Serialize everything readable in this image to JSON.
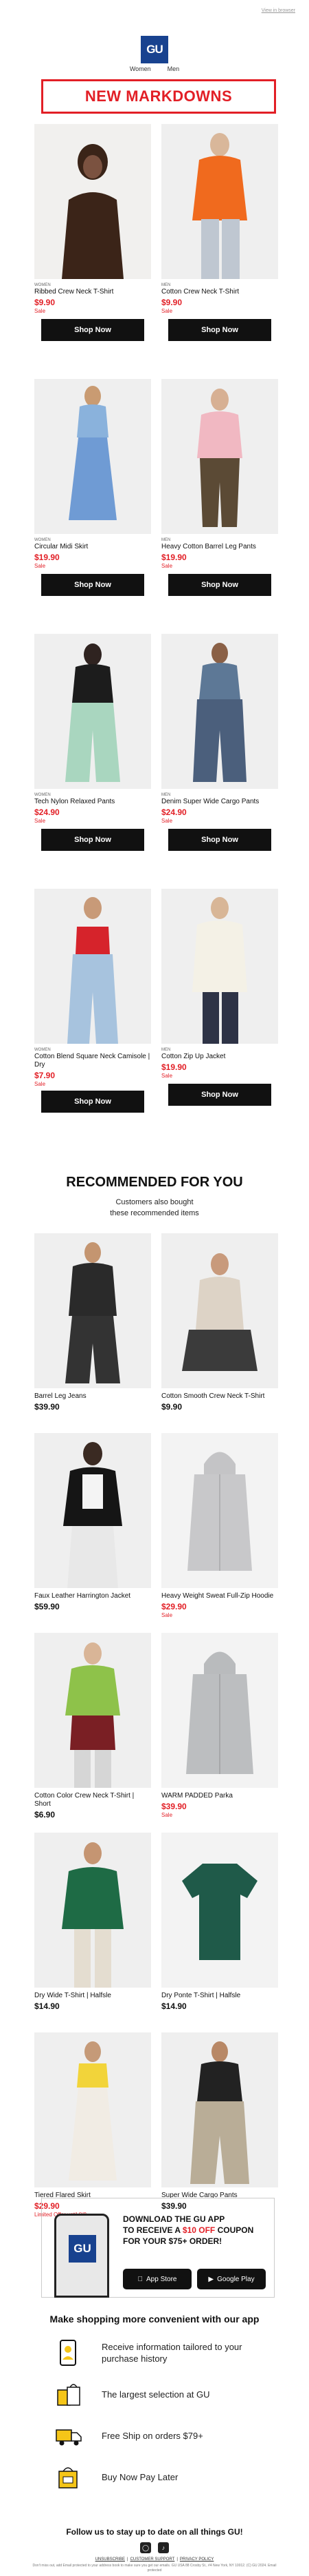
{
  "header": {
    "preheader_link": "View in browser",
    "logo": "GU",
    "nav": [
      "Women",
      "Men"
    ],
    "banner": "NEW MARKDOWNS"
  },
  "colors": {
    "brand_blue": "#18428f",
    "sale_red": "#e21f26",
    "button_black": "#111111"
  },
  "markdowns": [
    {
      "gender": "WOMEN",
      "name": "Ribbed Crew Neck T-Shirt",
      "price": "$9.90",
      "sale": "Sale",
      "button": "Shop Now"
    },
    {
      "gender": "MEN",
      "name": "Cotton Crew Neck T-Shirt",
      "price": "$9.90",
      "sale": "Sale",
      "button": "Shop Now"
    },
    {
      "gender": "WOMEN",
      "name": "Circular Midi Skirt",
      "price": "$19.90",
      "sale": "Sale",
      "button": "Shop Now"
    },
    {
      "gender": "MEN",
      "name": "Heavy Cotton Barrel Leg Pants",
      "price": "$19.90",
      "sale": "Sale",
      "button": "Shop Now"
    },
    {
      "gender": "WOMEN",
      "name": "Tech Nylon Relaxed Pants",
      "price": "$24.90",
      "sale": "Sale",
      "button": "Shop Now"
    },
    {
      "gender": "MEN",
      "name": "Denim Super Wide Cargo Pants",
      "price": "$24.90",
      "sale": "Sale",
      "button": "Shop Now"
    },
    {
      "gender": "WOMEN",
      "name": "Cotton Blend Square Neck Camisole | Dry",
      "price": "$7.90",
      "sale": "Sale",
      "button": "Shop Now"
    },
    {
      "gender": "MEN",
      "name": "Cotton Zip Up Jacket",
      "price": "$19.90",
      "sale": "Sale",
      "button": "Shop Now"
    }
  ],
  "recommended": {
    "title": "RECOMMENDED FOR YOU",
    "subtitle_line1": "Customers also bought",
    "subtitle_line2": "these recommended items",
    "items": [
      {
        "name": "Barrel Leg Jeans",
        "price": "$39.90",
        "sale": ""
      },
      {
        "name": "Cotton Smooth Crew Neck T-Shirt",
        "price": "$9.90",
        "sale": ""
      },
      {
        "name": "Faux Leather Harrington Jacket",
        "price": "$59.90",
        "sale": ""
      },
      {
        "name": "Heavy Weight Sweat Full-Zip Hoodie",
        "price": "$29.90",
        "sale": "Sale"
      },
      {
        "name": "Cotton Color Crew Neck T-Shirt | Short",
        "price": "$6.90",
        "sale": ""
      },
      {
        "name": "WARM PADDED Parka",
        "price": "$39.90",
        "sale": "Sale"
      },
      {
        "name": "Dry Wide T-Shirt | Halfsle",
        "price": "$14.90",
        "sale": ""
      },
      {
        "name": "Dry Ponte T-Shirt | Halfsle",
        "price": "$14.90",
        "sale": ""
      },
      {
        "name": "Tiered Flared Skirt",
        "price": "$29.90",
        "sale": "Limited Offer until 8/8"
      },
      {
        "name": "Super Wide Cargo Pants",
        "price": "$39.90",
        "sale": ""
      }
    ]
  },
  "app": {
    "logo": "GU",
    "line1": "DOWNLOAD THE GU APP",
    "line2_pre": "TO RECEIVE A ",
    "line2_hl": "$10 OFF",
    "line2_post": " COUPON",
    "line3": "FOR YOUR $75+ ORDER!",
    "appstore": "App Store",
    "googleplay": "Google Play"
  },
  "convenience": {
    "title": "Make shopping more convenient with our app",
    "features": [
      {
        "icon": "phone-person-icon",
        "text": "Receive information tailored to your purchase history"
      },
      {
        "icon": "shopping-bags-icon",
        "text": "The largest selection at GU"
      },
      {
        "icon": "delivery-truck-icon",
        "text": "Free Ship on orders $79+"
      },
      {
        "icon": "bag-card-icon",
        "text": "Buy Now Pay Later"
      }
    ]
  },
  "footer": {
    "follow": "Follow us to stay up to date on all things GU!",
    "links": [
      "UNSUBSCRIBE",
      "CUSTOMER SUPPORT",
      "PRIVACY POLICY"
    ],
    "address": "Don't miss out, add Email protected to your address book to make sure you get our emails. GU USA 88 Crosby St., #4 New York, NY 10012. (C) GU 2024. Email protected"
  }
}
